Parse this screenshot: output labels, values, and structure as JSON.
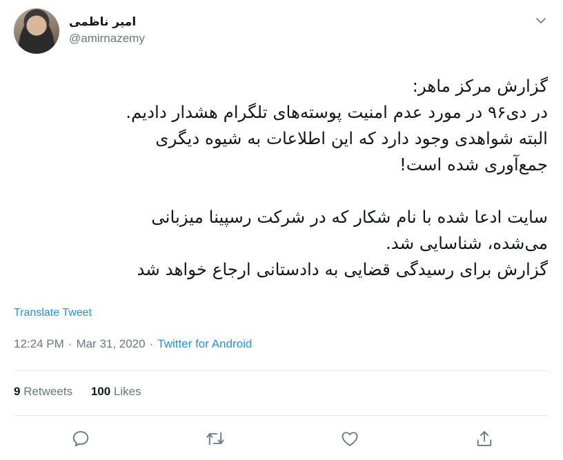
{
  "user": {
    "display_name": "امیر ناظمی",
    "handle": "@amirnazemy"
  },
  "tweet": {
    "lines": [
      "گزارش مرکز ماهر:",
      "در دی۹۶ در مورد عدم امنیت پوسته‌های تلگرام هشدار دادیم.",
      "البته شواهدی وجود دارد که این اطلاعات به شیوه دیگری",
      "جمع‌آوری شده است!",
      "",
      "سایت ادعا شده با نام شکار که در شرکت رسپینا میزبانی",
      "می‌شده، شناسایی شد.",
      "گزارش برای رسیدگی قضایی به دادستانی ارجاع خواهد شد"
    ]
  },
  "translate_label": "Translate Tweet",
  "meta": {
    "time": "12:24 PM",
    "separator": "·",
    "date": "Mar 31, 2020",
    "source": "Twitter for Android"
  },
  "stats": {
    "retweets_count": "9",
    "retweets_label": "Retweets",
    "likes_count": "100",
    "likes_label": "Likes"
  },
  "icons": {
    "reply": "reply-icon",
    "retweet": "retweet-icon",
    "like": "heart-icon",
    "share": "share-icon",
    "more": "chevron-down-icon"
  },
  "colors": {
    "link": "#1b95e0",
    "muted": "#657786",
    "divider": "#e6ecf0"
  }
}
